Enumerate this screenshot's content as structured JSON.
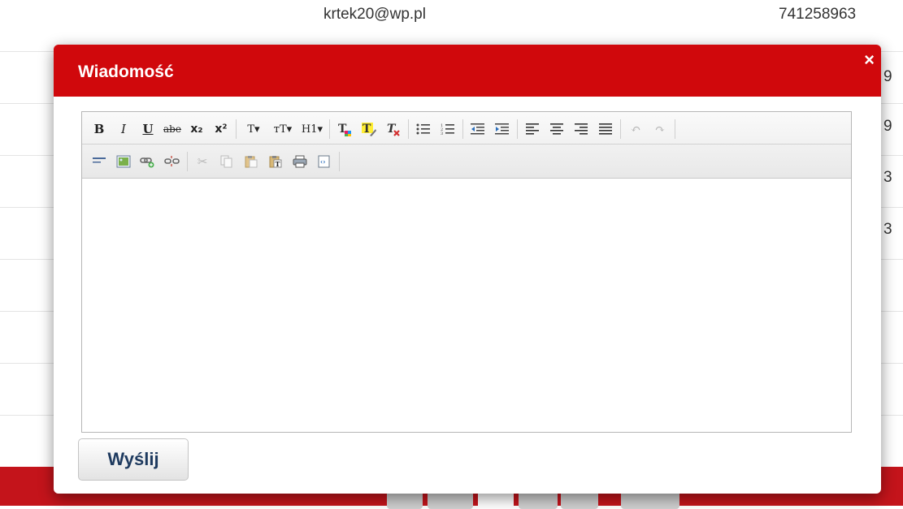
{
  "background_table": {
    "row1": {
      "email": "krtek20@wp.pl",
      "phone": "741258963"
    },
    "partial_digits": [
      "9",
      "9",
      "3",
      "3"
    ]
  },
  "modal": {
    "title": "Wiadomość",
    "close_glyph": "×",
    "send_label": "Wyślij"
  },
  "toolbar": {
    "row1": [
      {
        "name": "bold-icon",
        "glyph": "B"
      },
      {
        "name": "italic-icon",
        "glyph": "I"
      },
      {
        "name": "underline-icon",
        "glyph": "U"
      },
      {
        "name": "strikethrough-icon",
        "glyph": "abe"
      },
      {
        "name": "subscript-icon",
        "glyph": "x₂"
      },
      {
        "name": "superscript-icon",
        "glyph": "x²"
      },
      {
        "name": "font-family-icon",
        "glyph": "T▾"
      },
      {
        "name": "font-size-icon",
        "glyph": "тT▾"
      },
      {
        "name": "heading-icon",
        "glyph": "H1▾"
      },
      {
        "name": "text-color-icon",
        "glyph": "T"
      },
      {
        "name": "highlight-icon",
        "glyph": "T"
      },
      {
        "name": "remove-format-icon",
        "glyph": "T"
      },
      {
        "name": "bullet-list-icon",
        "glyph": "☰"
      },
      {
        "name": "numbered-list-icon",
        "glyph": "☰"
      },
      {
        "name": "outdent-icon",
        "glyph": "⇤"
      },
      {
        "name": "indent-icon",
        "glyph": "⇥"
      },
      {
        "name": "align-left-icon",
        "glyph": "≡"
      },
      {
        "name": "align-center-icon",
        "glyph": "≡"
      },
      {
        "name": "align-right-icon",
        "glyph": "≡"
      },
      {
        "name": "justify-icon",
        "glyph": "≡"
      },
      {
        "name": "undo-icon",
        "glyph": "↶"
      },
      {
        "name": "redo-icon",
        "glyph": "↷"
      }
    ],
    "row2": [
      {
        "name": "horizontal-rule-icon",
        "glyph": "≡"
      },
      {
        "name": "image-icon",
        "glyph": "▣"
      },
      {
        "name": "link-icon",
        "glyph": "⚭"
      },
      {
        "name": "unlink-icon",
        "glyph": "⚮"
      },
      {
        "name": "cut-icon",
        "glyph": "✂"
      },
      {
        "name": "copy-icon",
        "glyph": "⎘"
      },
      {
        "name": "paste-icon",
        "glyph": "📋"
      },
      {
        "name": "paste-text-icon",
        "glyph": "T"
      },
      {
        "name": "print-icon",
        "glyph": "⎙"
      },
      {
        "name": "source-icon",
        "glyph": "‹›"
      }
    ]
  },
  "colors": {
    "header": "#d0080c",
    "footer": "#c4141b",
    "send_text": "#1e3a5f"
  }
}
